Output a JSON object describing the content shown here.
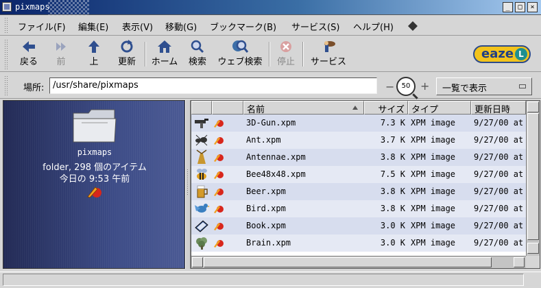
{
  "window": {
    "title": "pixmaps",
    "minimize": "_",
    "maximize": "□",
    "close": "×"
  },
  "menu": {
    "items": [
      "ファイル(F)",
      "編集(E)",
      "表示(V)",
      "移動(G)",
      "ブックマーク(B)",
      "サービス(S)",
      "ヘルプ(H)"
    ]
  },
  "toolbar": {
    "back": "戻る",
    "forward": "前",
    "up": "上",
    "reload": "更新",
    "home": "ホーム",
    "search": "検索",
    "web_search": "ウェブ検索",
    "stop": "停止",
    "services": "サービス",
    "logo": "eaze",
    "logo_chip": "L"
  },
  "location": {
    "label": "場所:",
    "path": "/usr/share/pixmaps",
    "zoom": "50",
    "view_as": "一覧で表示"
  },
  "sidebar": {
    "name": "pixmaps",
    "info": "folder, 298 個のアイテム",
    "date": "今日の 9:53 午前"
  },
  "list": {
    "columns": [
      "名前",
      "サイズ",
      "タイプ",
      "更新日時"
    ],
    "rows": [
      {
        "name": "3D-Gun.xpm",
        "size": "7.3 K",
        "type": "XPM image",
        "date": "9/27/00 at"
      },
      {
        "name": "Ant.xpm",
        "size": "3.7 K",
        "type": "XPM image",
        "date": "9/27/00 at"
      },
      {
        "name": "Antennae.xpm",
        "size": "3.8 K",
        "type": "XPM image",
        "date": "9/27/00 at"
      },
      {
        "name": "Bee48x48.xpm",
        "size": "7.5 K",
        "type": "XPM image",
        "date": "9/27/00 at"
      },
      {
        "name": "Beer.xpm",
        "size": "3.8 K",
        "type": "XPM image",
        "date": "9/27/00 at"
      },
      {
        "name": "Bird.xpm",
        "size": "3.8 K",
        "type": "XPM image",
        "date": "9/27/00 at"
      },
      {
        "name": "Book.xpm",
        "size": "3.0 K",
        "type": "XPM image",
        "date": "9/27/00 at"
      },
      {
        "name": "Brain.xpm",
        "size": "3.0 K",
        "type": "XPM image",
        "date": "9/27/00 at"
      }
    ]
  },
  "icons": {
    "menu_extra": "diamond-icon",
    "emblem": "pen-emblem-icon",
    "folder": "folder-icon"
  }
}
